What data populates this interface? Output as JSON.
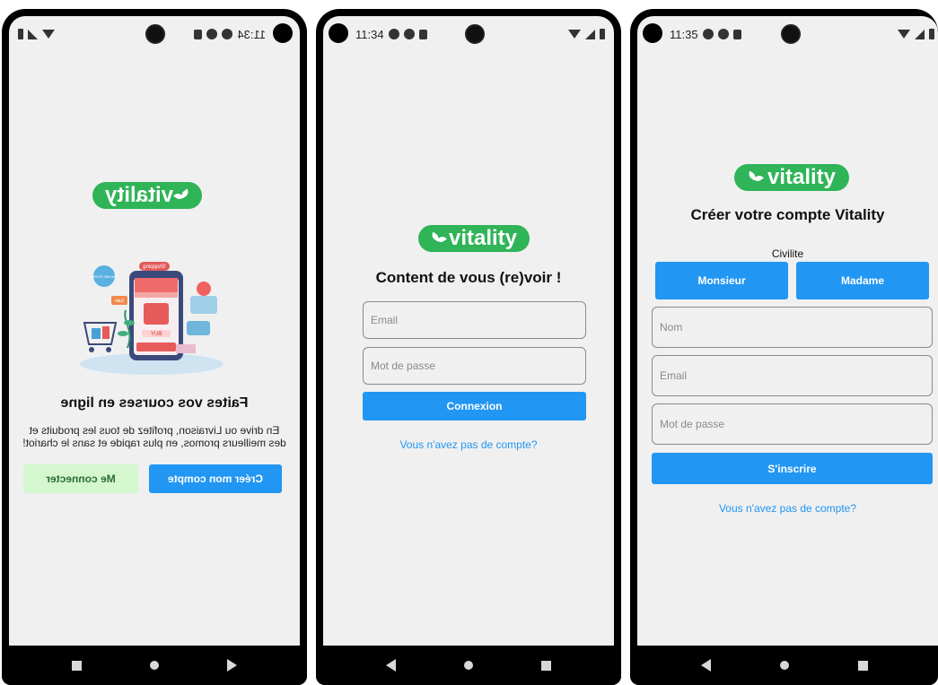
{
  "screen1": {
    "status_time": "11:34",
    "logo_text": "vitality",
    "illustration_labels": {
      "shopping": "Shopping",
      "buy": "BUY",
      "sale": "Sale",
      "online_store": "ONLINE STORE"
    },
    "title": "Faites vos courses en ligne",
    "description": "En drive ou Livraison, profitez de tous les produits et des meilleurs promos, en plus rapide et sans le chariot!",
    "create_button": "Créer mon compte",
    "login_button": "Me connecter"
  },
  "screen2": {
    "status_time": "11:34",
    "logo_text": "vitality",
    "title": "Content de vous (re)voir !",
    "email_placeholder": "Email",
    "password_placeholder": "Mot de passe",
    "login_button": "Connexion",
    "no_account_link": "Vous n'avez pas de compte?"
  },
  "screen3": {
    "status_time": "11:35",
    "logo_text": "vitality",
    "title": "Créer votre compte Vitality",
    "civility_label": "Civilite",
    "civility_options": [
      "Monsieur",
      "Madame"
    ],
    "name_placeholder": "Nom",
    "email_placeholder": "Email",
    "password_placeholder": "Mot de passe",
    "signup_button": "S'inscrire",
    "no_account_link": "Vous n'avez pas de compte?"
  },
  "colors": {
    "brand_green": "#2fb457",
    "primary_blue": "#2196f3",
    "light_green": "#d4f7cf",
    "screen_bg": "#f0f0f0"
  }
}
